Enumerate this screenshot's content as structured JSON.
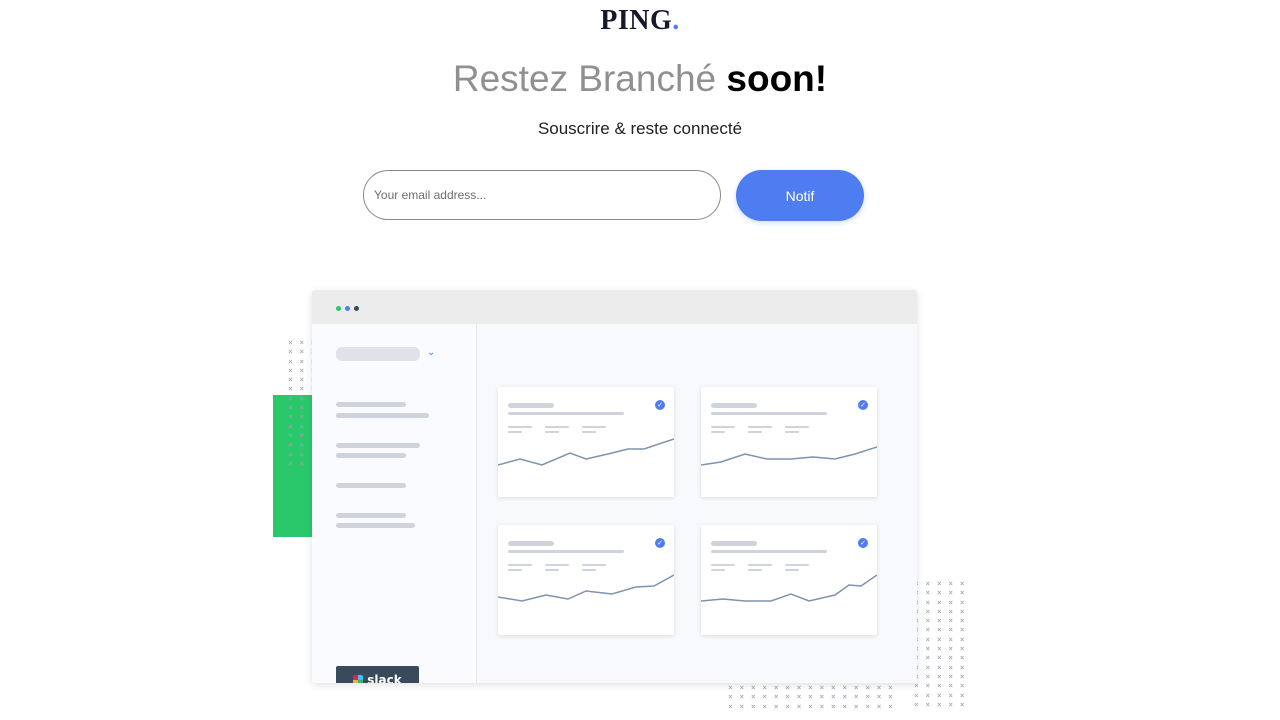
{
  "brand": {
    "name": "PING",
    "dot": "."
  },
  "hero": {
    "headline_light": "Restez Branché",
    "headline_bold": "soon!",
    "subtitle": "Souscrire & reste connecté"
  },
  "form": {
    "email_placeholder": "Your email address...",
    "email_value": "",
    "submit_label": "Notif"
  },
  "illustration": {
    "slack_label": "slack",
    "window_dots": [
      "#2bc86b",
      "#4e7df1",
      "#394a5c"
    ]
  },
  "colors": {
    "accent": "#4e7df1",
    "green": "#2bc86b",
    "dark": "#16192b",
    "muted_text": "#909090"
  }
}
